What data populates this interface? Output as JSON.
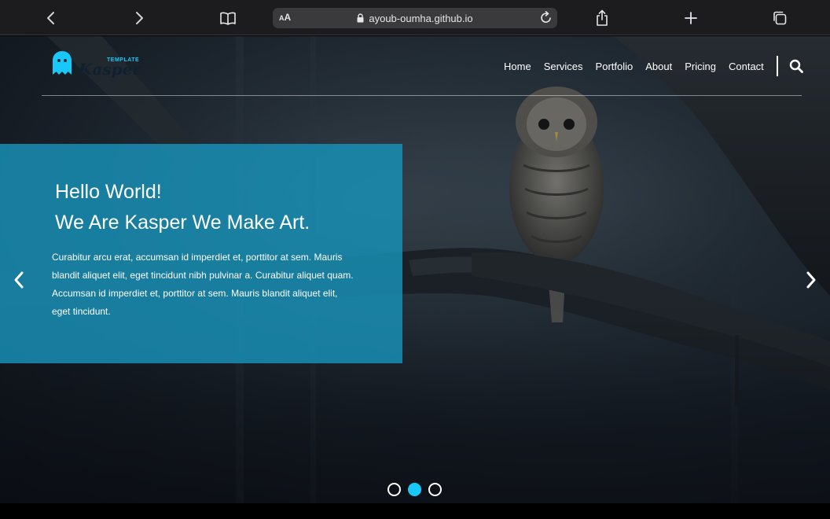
{
  "browser": {
    "text_size_label": "AA",
    "url": "ayoub-oumha.github.io"
  },
  "site": {
    "logo_small_text": "TEMPLATE",
    "logo_name": "Kasper",
    "nav": [
      "Home",
      "Services",
      "Portfolio",
      "About",
      "Pricing",
      "Contact"
    ]
  },
  "hero": {
    "title_line1": "Hello World!",
    "title_line2": "We Are Kasper We Make Art.",
    "body": "Curabitur arcu erat, accumsan id imperdiet et, porttitor at sem. Mauris blandit aliquet elit, eget tincidunt nibh pulvinar a. Curabitur aliquet quam. Accumsan id imperdiet et, porttitor at sem. Mauris blandit aliquet elit, eget tincidunt.",
    "slides_count": 3,
    "active_slide": 2
  },
  "colors": {
    "accent": "#19c8fa",
    "panel": "#1892ba",
    "chrome_bg": "#1c1c1e"
  },
  "icons": [
    "back-icon",
    "forward-icon",
    "bookmarks-icon",
    "lock-icon",
    "reload-icon",
    "share-icon",
    "new-tab-icon",
    "tabs-icon",
    "ghost-logo-icon",
    "search-icon",
    "chevron-left-icon",
    "chevron-right-icon"
  ]
}
